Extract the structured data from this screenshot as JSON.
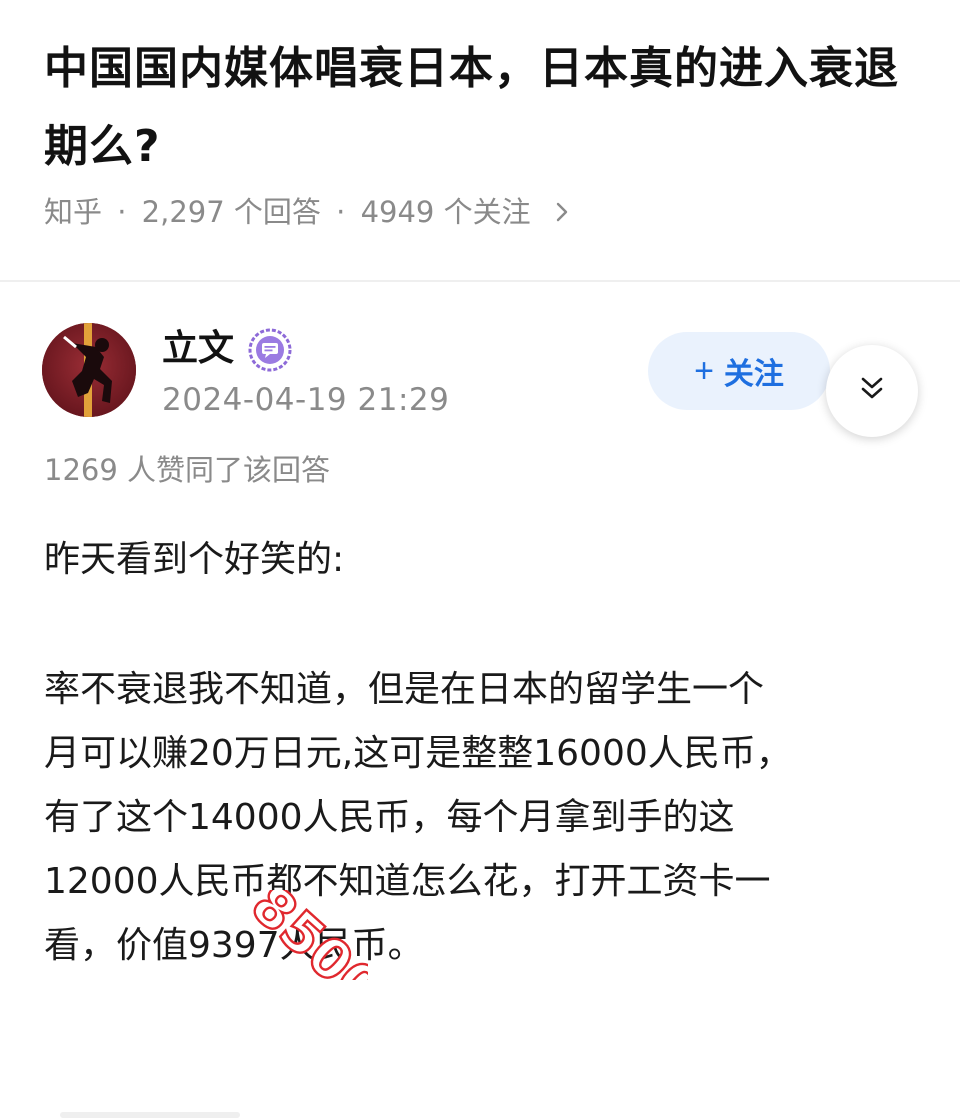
{
  "question": {
    "title": "中国国内媒体唱衰日本，日本真的进入衰退期么?",
    "source": "知乎",
    "answers": "2,297 个回答",
    "followers": "4949 个关注",
    "separator": "·"
  },
  "author": {
    "name": "立文",
    "time": "2024-04-19 21:29",
    "avatar_icon": "avatar-climber-silhouette",
    "badge_icon": "creator-chat-badge-icon"
  },
  "actions": {
    "follow_label": "关注",
    "follow_plus": "+",
    "collapse_icon": "double-chevron-down-icon",
    "accent_color": "#1e6fe0"
  },
  "upvotes": "1269 人赞同了该回答",
  "answer": {
    "paragraph1": "昨天看到个好笑的:",
    "paragraph2_lines": [
      "率不衰退我不知道，但是在日本的留学生一个",
      "月可以赚20万日元,这可是整整16000人民币，",
      "有了这个14000人民币，每个月拿到手的这",
      "12000人民币都不知道怎么花，打开工资卡一",
      "看，价值9397人民币。"
    ]
  },
  "overlay_stamp": "8500"
}
